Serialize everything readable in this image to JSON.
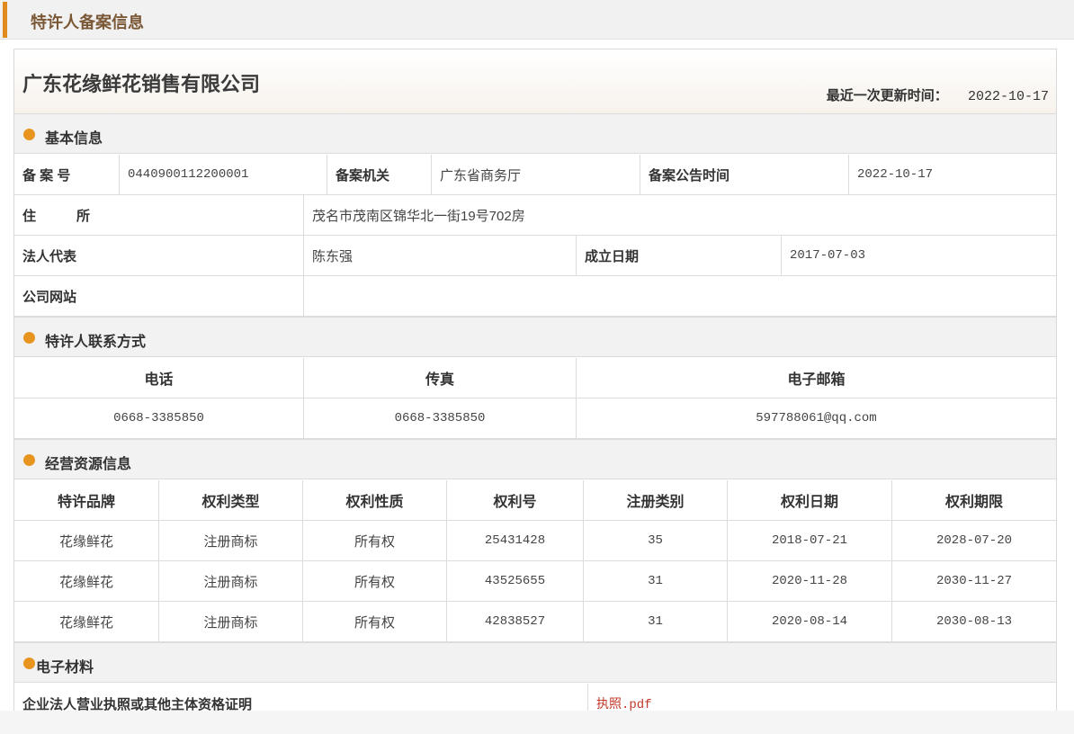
{
  "header": {
    "title": "特许人备案信息"
  },
  "company": {
    "name": "广东花缘鲜花销售有限公司",
    "update_label": "最近一次更新时间：",
    "update_value": "2022-10-17"
  },
  "basic": {
    "section_title": "基本信息",
    "record_no_label": "备 案 号",
    "record_no_value": "0440900112200001",
    "authority_label": "备案机关",
    "authority_value": "广东省商务厅",
    "announce_label": "备案公告时间",
    "announce_value": "2022-10-17",
    "address_label": "住　　　所",
    "address_value": "茂名市茂南区锦华北一街19号702房",
    "legal_label": "法人代表",
    "legal_value": "陈东强",
    "established_label": "成立日期",
    "established_value": "2017-07-03",
    "website_label": "公司网站",
    "website_value": ""
  },
  "contact": {
    "section_title": "特许人联系方式",
    "headers": [
      "电话",
      "传真",
      "电子邮箱"
    ],
    "values": [
      "0668-3385850",
      "0668-3385850",
      "597788061@qq.com"
    ]
  },
  "resources": {
    "section_title": "经营资源信息",
    "headers": [
      "特许品牌",
      "权利类型",
      "权利性质",
      "权利号",
      "注册类别",
      "权利日期",
      "权利期限"
    ],
    "rows": [
      [
        "花缘鲜花",
        "注册商标",
        "所有权",
        "25431428",
        "35",
        "2018-07-21",
        "2028-07-20"
      ],
      [
        "花缘鲜花",
        "注册商标",
        "所有权",
        "43525655",
        "31",
        "2020-11-28",
        "2030-11-27"
      ],
      [
        "花缘鲜花",
        "注册商标",
        "所有权",
        "42838527",
        "31",
        "2020-08-14",
        "2030-08-13"
      ]
    ]
  },
  "materials": {
    "section_title": "电子材料",
    "license_label": "企业法人营业执照或其他主体资格证明",
    "license_file": "执照.pdf"
  },
  "colors": {
    "accent": "#e08a1e",
    "dot": "#e8951f",
    "header_title": "#7a5836",
    "link": "#c0392b"
  }
}
